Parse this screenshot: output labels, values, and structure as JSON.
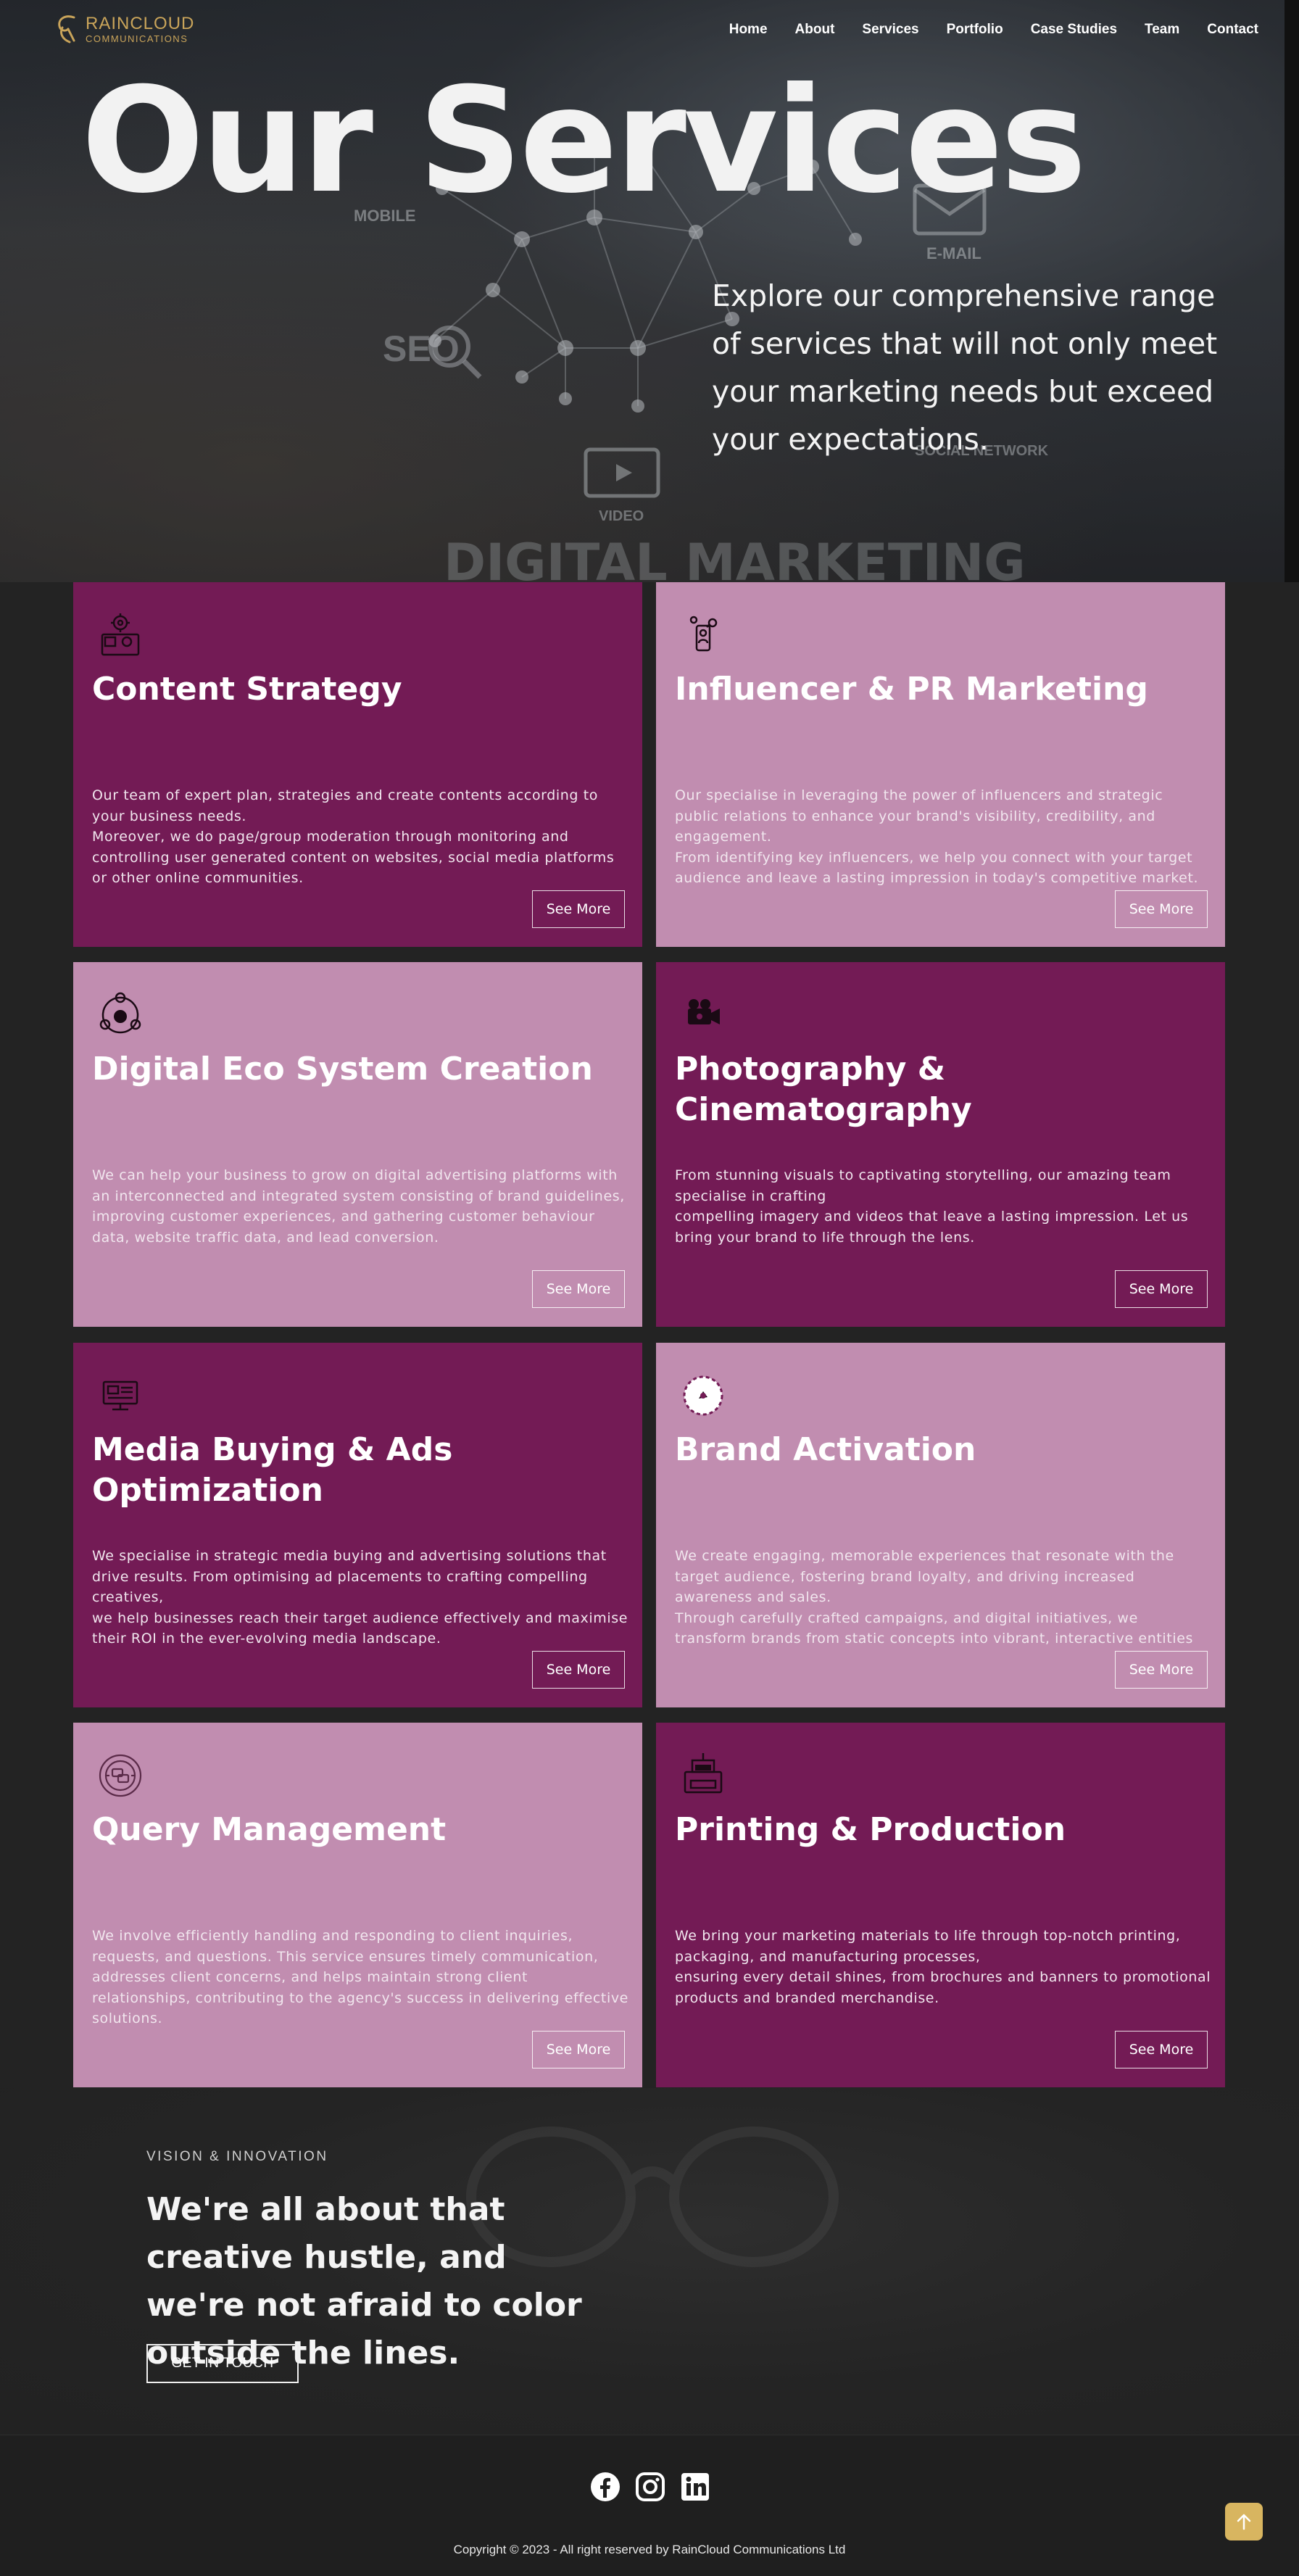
{
  "brand": {
    "name_line1": "RAINCLOUD",
    "name_line2": "COMMUNICATIONS",
    "color": "#c9a45a"
  },
  "nav": {
    "items": [
      {
        "label": "Home"
      },
      {
        "label": "Services"
      },
      {
        "label": "Portfolio"
      },
      {
        "label": "Case Studies"
      },
      {
        "label": "Team"
      },
      {
        "label": "Contact"
      }
    ],
    "about": "About"
  },
  "hero": {
    "title": "Our Services",
    "subtitle": "Explore our comprehensive range of services that will not only meet your marketing needs but exceed your expectations.",
    "background_words": [
      "MOBILE",
      "E-MAIL",
      "SEO",
      "SOCIAL NETWORK",
      "VIDEO",
      "DIGITAL MARKETING"
    ]
  },
  "services": [
    {
      "title": "Content Strategy",
      "icon": "content-strategy-icon",
      "theme": "dark",
      "paragraphs": [
        "Our team of expert plan, strategies and create contents according to your business needs.",
        "Moreover, we do page/group moderation through monitoring and controlling user generated content on websites, social media platforms or other online communities."
      ],
      "button": "See More"
    },
    {
      "title": "Influencer & PR Marketing",
      "icon": "influencer-icon",
      "theme": "light",
      "paragraphs": [
        "Our specialise in leveraging the power of influencers and strategic public relations to enhance your brand's visibility, credibility, and engagement.",
        "From identifying key influencers, we help you connect with your target audience and leave a lasting impression in today's competitive market."
      ],
      "button": "See More"
    },
    {
      "title": "Digital Eco System Creation",
      "icon": "ecosystem-icon",
      "theme": "light",
      "paragraphs": [
        "We can help your business to grow on digital advertising platforms with an interconnected and integrated system consisting of brand guidelines,",
        "improving customer experiences, and gathering customer behaviour data, website traffic data, and lead conversion."
      ],
      "button": "See More"
    },
    {
      "title": "Photography & Cinematography",
      "icon": "camera-icon",
      "theme": "dark",
      "paragraphs": [
        "From stunning visuals to captivating storytelling, our amazing team specialise in crafting",
        "compelling imagery and videos that leave a lasting impression. Let us bring your brand to life through the lens."
      ],
      "button": "See More"
    },
    {
      "title": "Media Buying & Ads Optimization",
      "icon": "media-buying-icon",
      "theme": "dark",
      "paragraphs": [
        "We specialise in strategic media buying and advertising solutions that drive results. From optimising ad placements to crafting compelling creatives,",
        "we help businesses reach their target audience effectively and maximise their ROI in the ever-evolving media landscape."
      ],
      "button": "See More"
    },
    {
      "title": "Brand Activation",
      "icon": "brand-activation-icon",
      "theme": "light",
      "paragraphs": [
        "We create engaging, memorable experiences that resonate with the target audience, fostering brand loyalty, and driving increased awareness and sales.",
        "Through carefully crafted campaigns, and digital initiatives, we transform brands from static concepts into vibrant, interactive entities"
      ],
      "button": "See More"
    },
    {
      "title": "Query Management",
      "icon": "query-management-icon",
      "theme": "light",
      "paragraphs": [
        "We involve efficiently handling and responding to client inquiries, requests, and questions. This service ensures timely communication, addresses client concerns, and helps maintain strong client relationships, contributing to the agency's success in delivering effective solutions."
      ],
      "button": "See More"
    },
    {
      "title": "Printing & Production",
      "icon": "printer-icon",
      "theme": "dark",
      "paragraphs": [
        "We bring your marketing materials to life through top-notch printing, packaging, and manufacturing processes,",
        "ensuring every detail shines, from brochures and banners to promotional products and branded merchandise."
      ],
      "button": "See More"
    }
  ],
  "vision": {
    "kicker": "VISION & INNOVATION",
    "heading": "We're all about that creative hustle, and we're not afraid to color outside the lines.",
    "button": "GET IN TOUCH"
  },
  "footer": {
    "socials": [
      "facebook-icon",
      "instagram-icon",
      "linkedin-icon"
    ],
    "copyright": "Copyright © 2023 - All right reserved by RainCloud Communications Ltd"
  },
  "colors": {
    "card_dark": "#731b55",
    "card_light": "#c18db0",
    "accent_gold": "#d8b560",
    "page_bg": "#232323"
  }
}
